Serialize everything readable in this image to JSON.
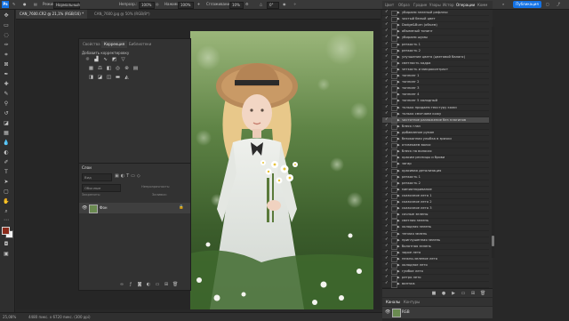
{
  "options_bar": {
    "app_badge": "Ps",
    "mode_label": "Режим:",
    "mode_value": "Нормальный",
    "opacity_label": "Непрозр.:",
    "opacity_value": "100%",
    "pressure_label": "Нажим:",
    "pressure_value": "100%",
    "smoothing_label": "Сглаживание:",
    "smoothing_value": "10%",
    "angle_value": "0°",
    "publish_button": "Публикация"
  },
  "doc_tabs": [
    {
      "label": "CAN_7600.CR2 @ 21,1% (RGB/16) *"
    },
    {
      "label": "CAN_7600.jpg @ 50% (RGB/8*)"
    }
  ],
  "adjustments_panel": {
    "tabs": [
      "Свойства",
      "Коррекция",
      "Библиотеки"
    ],
    "active_tab": "Коррекция",
    "hint": "Добавить корректировку"
  },
  "layers_panel": {
    "title": "Слои",
    "filter_placeholder": "Вид",
    "mode": "Обычные",
    "opacity_label": "Непрозрачность:",
    "lock_label": "Закрепить:",
    "fill_label": "Заливка:",
    "layer_name": "Фон"
  },
  "right_panel": {
    "tabs": [
      "Цвет",
      "Образ",
      "Градие",
      "Узоры",
      "Истор",
      "Операции",
      "Комм"
    ],
    "active_tab": "Операции",
    "actions": [
      "убираем зеленый рефлекс",
      "чистый белый цвет",
      "Dodge&Burn (объем)",
      "объемный тонинг",
      "убираем шумы",
      "резкость 1",
      "резкость 2",
      "улучшение цвета (цветовой баланс)",
      "светлость кадра",
      "четкость и микроконтраст",
      "тоннинг 1",
      "тоннинг 2",
      "тоннинг 3",
      "тоннинг 4",
      "тоннинг 5 холодный",
      "только придаем текстуру кожи",
      "только смягчаем кожу",
      "частотное разложение без плагинов",
      "блеск глаз",
      "добавление румян",
      "безоконная улыбка в зрачки",
      "отсвекаем волос",
      "блеск на волосах",
      "красим ресницы и брови",
      "загар",
      "красивая детализация",
      "резкость 1",
      "резкость 2",
      "миниатюривание",
      "сказочное лето 1",
      "сказочное лето 2",
      "сказочное лето 3",
      "сочные зелены",
      "светлая зелень",
      "холодная зелень",
      "теплая зелень",
      "приглушенная зелень",
      "болотная зелень",
      "зарое лето",
      "нежно-зеленое лето",
      "холодное лето",
      "гумбое лето",
      "ретро лето",
      "винтаж"
    ],
    "selected_action": "частотное разложение без плагинов",
    "bottom_tabs": [
      "Каналы",
      "Контуры"
    ],
    "channel_name": "RGB"
  },
  "status_bar": {
    "zoom": "25,08%",
    "info": "4480 пикс. x 6720 пикс. (300 ppi)"
  }
}
